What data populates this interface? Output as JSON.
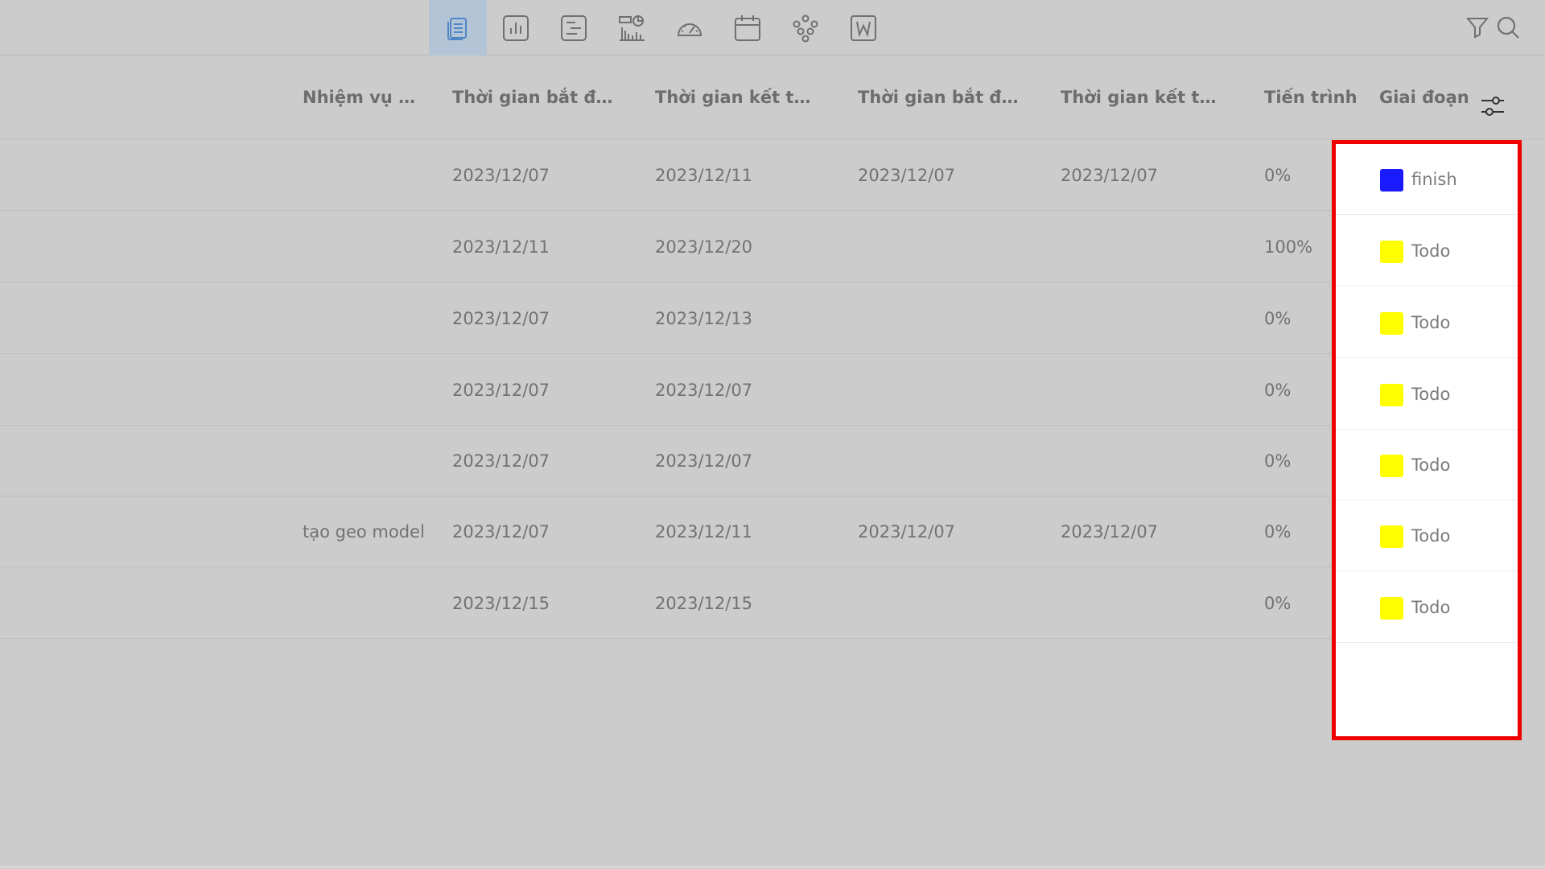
{
  "toolbar": {
    "views": [
      {
        "icon": "table-view-icon",
        "active": true
      },
      {
        "icon": "bar-chart-icon",
        "active": false
      },
      {
        "icon": "list-view-icon",
        "active": false
      },
      {
        "icon": "dashboard-chart-icon",
        "active": false
      },
      {
        "icon": "gauge-icon",
        "active": false
      },
      {
        "icon": "calendar-icon",
        "active": false
      },
      {
        "icon": "org-chart-icon",
        "active": false
      },
      {
        "icon": "word-document-icon",
        "active": false
      }
    ],
    "right_icons": [
      "filter-icon",
      "search-icon"
    ]
  },
  "table": {
    "headers": {
      "parent_task": "Nhiệm vụ cha",
      "planned_start": "Thời gian bắt đầu ...",
      "planned_end": "Thời gian kết thúc ...",
      "actual_start": "Thời gian bắt đầu t...",
      "actual_end": "Thời gian kết thúc ...",
      "progress": "Tiến trình",
      "stage": "Giai đoạn"
    },
    "settings_icon": "column-settings-icon",
    "rows": [
      {
        "parent_task": "",
        "planned_start": "2023/12/07",
        "planned_end": "2023/12/11",
        "actual_start": "2023/12/07",
        "actual_end": "2023/12/07",
        "progress": "0%",
        "stage": "finish",
        "stage_color": "#1a1aff"
      },
      {
        "parent_task": "",
        "planned_start": "2023/12/11",
        "planned_end": "2023/12/20",
        "actual_start": "",
        "actual_end": "",
        "progress": "100%",
        "stage": "Todo",
        "stage_color": "#ffff00"
      },
      {
        "parent_task": "",
        "planned_start": "2023/12/07",
        "planned_end": "2023/12/13",
        "actual_start": "",
        "actual_end": "",
        "progress": "0%",
        "stage": "Todo",
        "stage_color": "#ffff00"
      },
      {
        "parent_task": "",
        "planned_start": "2023/12/07",
        "planned_end": "2023/12/07",
        "actual_start": "",
        "actual_end": "",
        "progress": "0%",
        "stage": "Todo",
        "stage_color": "#ffff00"
      },
      {
        "parent_task": "",
        "planned_start": "2023/12/07",
        "planned_end": "2023/12/07",
        "actual_start": "",
        "actual_end": "",
        "progress": "0%",
        "stage": "Todo",
        "stage_color": "#ffff00"
      },
      {
        "parent_task": "tạo geo model",
        "planned_start": "2023/12/07",
        "planned_end": "2023/12/11",
        "actual_start": "2023/12/07",
        "actual_end": "2023/12/07",
        "progress": "0%",
        "stage": "Todo",
        "stage_color": "#ffff00"
      },
      {
        "parent_task": "",
        "planned_start": "2023/12/15",
        "planned_end": "2023/12/15",
        "actual_start": "",
        "actual_end": "",
        "progress": "0%",
        "stage": "Todo",
        "stage_color": "#ffff00"
      }
    ]
  },
  "colors": {
    "highlight_border": "#ee0000",
    "active_view": "#b3c4d6"
  }
}
